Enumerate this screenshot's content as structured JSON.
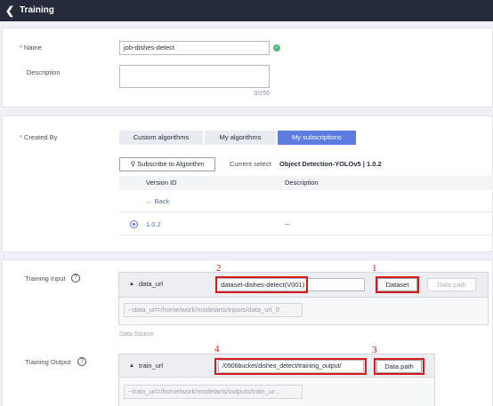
{
  "header": {
    "title": "Training",
    "back_icon": "chevron-left-icon"
  },
  "basic": {
    "name_label": "Name",
    "name_value": "job-dishes-detect",
    "description_label": "Description",
    "description_value": "",
    "description_counter": "0/256",
    "status_icon": "check-circle-icon"
  },
  "created_by": {
    "label": "Created By",
    "tabs": [
      {
        "label": "Custom algorithms",
        "active": false
      },
      {
        "label": "My algorithms",
        "active": false
      },
      {
        "label": "My subscriptions",
        "active": true
      }
    ],
    "subscribe_button": "Subscribe to Algorithm",
    "current_select_label": "Current select",
    "current_select_value": "Object Detection-YOLOv5 | 1.0.2",
    "table": {
      "columns": [
        "Version ID",
        "Description"
      ],
      "back_link": "Back",
      "rows": [
        {
          "version": "1.0.2",
          "description": "--",
          "selected": true
        }
      ]
    }
  },
  "training_input": {
    "label": "Training Input",
    "param_name": "data_url",
    "value": "dataset-dishes-detect(V001)",
    "dataset_button": "Dataset",
    "data_path_button": "Data path",
    "cli_hint": "--data_url=/home/work/modelarts/inputs/data_url_0",
    "data_source_label": "Data Source",
    "annotations": [
      "2",
      "1"
    ]
  },
  "training_output": {
    "label": "Training Output",
    "param_name": "train_url",
    "value": "/0906bucket/dishes_detect/training_output/",
    "data_path_button": "Data path",
    "cli_hint": "--train_url=/home/work/modelarts/outputs/train_ur...",
    "annotations": [
      "4",
      "3"
    ]
  },
  "colors": {
    "accent": "#5e7ce0",
    "annotation": "#d41c1c",
    "topbar": "#252b3a",
    "success": "#50b87a"
  }
}
